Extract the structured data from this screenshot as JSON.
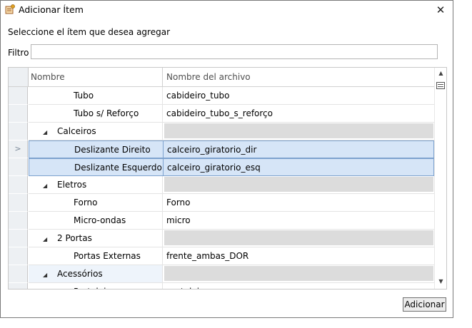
{
  "window": {
    "title": "Adicionar Ítem",
    "close_glyph": "✕"
  },
  "instruction": "Seleccione el ítem que desea agregar",
  "filter": {
    "label": "Filtro",
    "value": ""
  },
  "grid": {
    "columns": [
      "Nombre",
      "Nombre del archivo"
    ],
    "rows": [
      {
        "type": "child",
        "name": "Tubo",
        "file": "cabideiro_tubo",
        "indicator": ""
      },
      {
        "type": "child",
        "name": "Tubo s/ Reforço",
        "file": "cabideiro_tubo_s_reforço",
        "indicator": ""
      },
      {
        "type": "group",
        "name": "Calceiros",
        "file": "",
        "indicator": ""
      },
      {
        "type": "child",
        "name": "Deslizante Direito",
        "file": "calceiro_giratorio_dir",
        "indicator": ">",
        "selected": true
      },
      {
        "type": "child",
        "name": "Deslizante Esquerdo",
        "file": "calceiro_giratorio_esq",
        "indicator": "",
        "selected": true
      },
      {
        "type": "group",
        "name": "Eletros",
        "file": "",
        "indicator": ""
      },
      {
        "type": "child",
        "name": "Forno",
        "file": "Forno",
        "indicator": ""
      },
      {
        "type": "child",
        "name": "Micro-ondas",
        "file": "micro",
        "indicator": ""
      },
      {
        "type": "group",
        "name": "2 Portas",
        "file": "",
        "indicator": ""
      },
      {
        "type": "child",
        "name": "Portas Externas",
        "file": "frente_ambas_DOR",
        "indicator": ""
      },
      {
        "type": "group",
        "name": "Acessórios",
        "file": "",
        "indicator": "",
        "highlight": true
      },
      {
        "type": "child",
        "name": "Prateleira",
        "file": "prateleira",
        "indicator": ""
      }
    ]
  },
  "buttons": {
    "add_label": "Adicionar"
  },
  "icons": {
    "app": "add-item-icon",
    "expander": "triangle-down-icon",
    "row_indicator": "chevron-right-icon"
  }
}
